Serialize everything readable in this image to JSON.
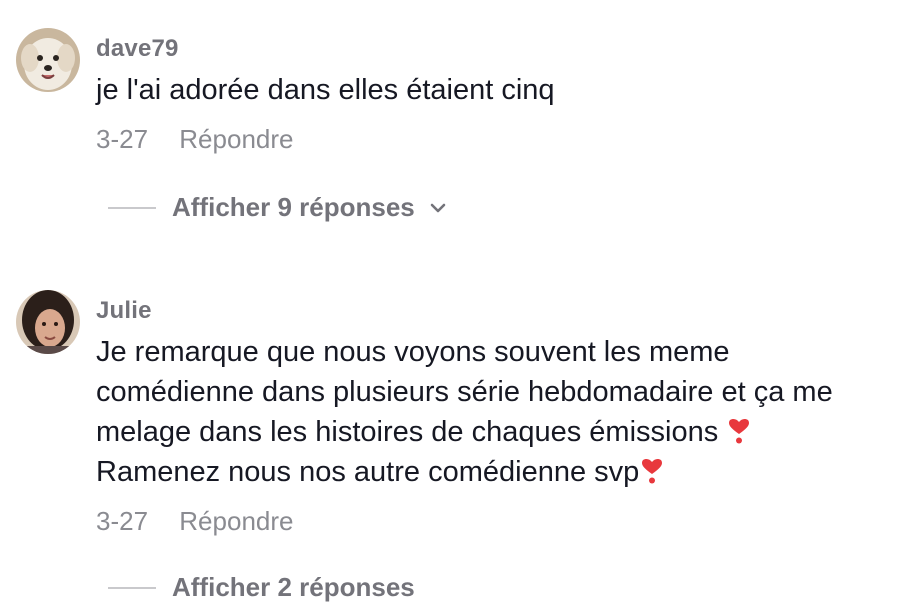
{
  "comments": [
    {
      "username": "dave79",
      "text": "je l'ai adorée dans elles étaient cinq",
      "date": "3-27",
      "reply_label": "Répondre",
      "view_replies_label": "Afficher 9 réponses",
      "avatar_icon": "dog-avatar"
    },
    {
      "username": "Julie",
      "text_line1": "Je remarque que nous voyons souvent les meme",
      "text_line2": "comédienne dans plusieurs série hebdomadaire et ça me",
      "text_line3": "melage dans les histoires de chaques émissions",
      "text_line4": "Ramenez nous nos autre comédienne svp",
      "emoji": "heart-exclamation-icon",
      "date": "3-27",
      "reply_label": "Répondre",
      "view_replies_label": "Afficher 2 réponses",
      "avatar_icon": "woman-avatar"
    }
  ],
  "colors": {
    "text": "#161823",
    "username": "#73737a",
    "meta": "#8a8b91",
    "heart": "#e8383d"
  }
}
